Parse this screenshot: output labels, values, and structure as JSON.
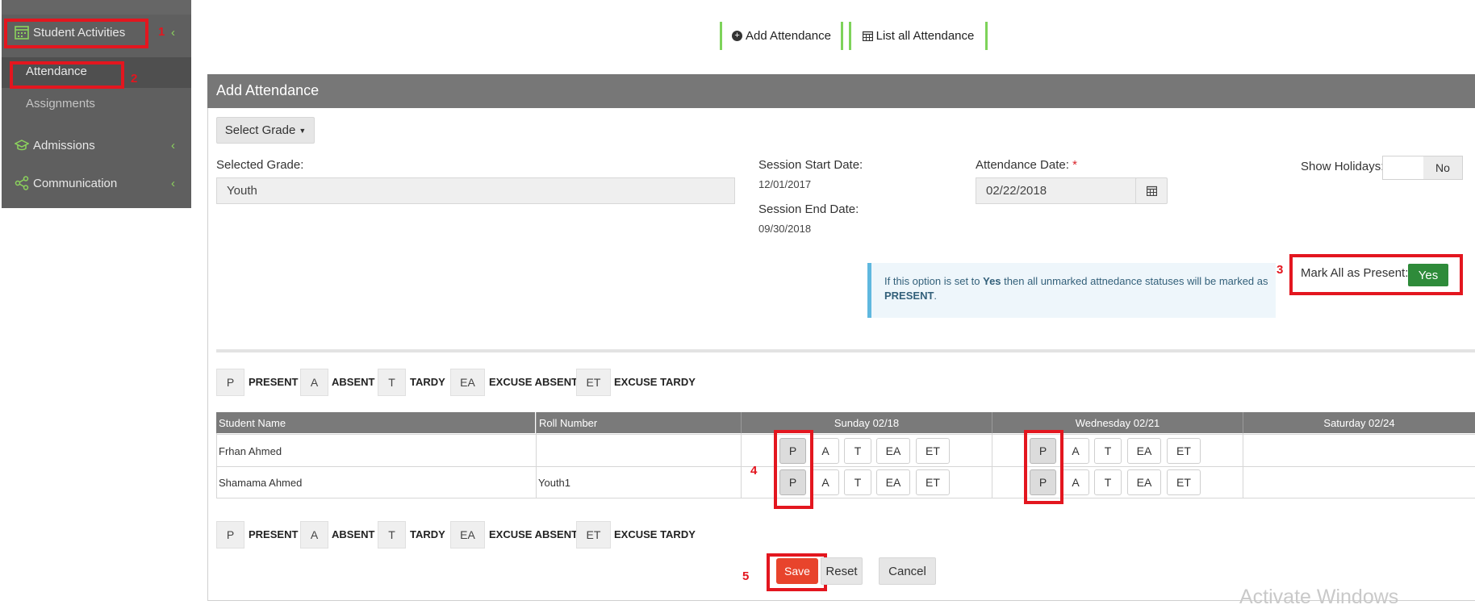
{
  "sidebar": {
    "items": [
      {
        "label": "Student Activities",
        "icon": "calendar-icon"
      },
      {
        "label": "Attendance"
      },
      {
        "label": "Assignments"
      },
      {
        "label": "Admissions",
        "icon": "graduation-cap-icon"
      },
      {
        "label": "Communication",
        "icon": "share-icon"
      }
    ]
  },
  "annotations": [
    "1",
    "2",
    "3",
    "4",
    "5"
  ],
  "top_actions": {
    "add_attendance": "Add Attendance",
    "list_all_attendance": "List all Attendance"
  },
  "panel": {
    "title": "Add Attendance",
    "select_grade": "Select Grade",
    "selected_grade_label": "Selected Grade:",
    "selected_grade_value": "Youth",
    "session_start_label": "Session Start Date:",
    "session_start_value": "12/01/2017",
    "session_end_label": "Session End Date:",
    "session_end_value": "09/30/2018",
    "attendance_date_label": "Attendance Date:",
    "required_mark": "*",
    "attendance_date_value": "02/22/2018",
    "show_holidays_label": "Show Holidays:",
    "show_holidays_value": "No",
    "info_pre": "If this option is set to ",
    "info_yes": "Yes",
    "info_mid": " then all unmarked attnedance statuses will be marked as ",
    "info_present": "PRESENT",
    "info_end": ".",
    "mark_all_label": "Mark All as Present:",
    "mark_all_value": "Yes"
  },
  "legend": [
    {
      "code": "P",
      "label": "PRESENT"
    },
    {
      "code": "A",
      "label": "ABSENT"
    },
    {
      "code": "T",
      "label": "TARDY"
    },
    {
      "code": "EA",
      "label": "EXCUSE ABSENT"
    },
    {
      "code": "ET",
      "label": "EXCUSE TARDY"
    }
  ],
  "table": {
    "headers": [
      "Student Name",
      "Roll Number",
      "Sunday 02/18",
      "Wednesday 02/21",
      "Saturday 02/24"
    ],
    "rows": [
      {
        "name": "Frhan Ahmed",
        "roll": ""
      },
      {
        "name": "Shamama Ahmed",
        "roll": "Youth1"
      }
    ],
    "options": [
      "P",
      "A",
      "T",
      "EA",
      "ET"
    ],
    "selected_option": "P"
  },
  "buttons": {
    "save": "Save",
    "reset": "Reset",
    "cancel": "Cancel"
  },
  "watermark": "Activate Windows",
  "colors": {
    "accent_green": "#7ed35a",
    "annotation_red": "#e3161f",
    "save_red": "#e8442c",
    "yes_green": "#2e8b3a"
  }
}
